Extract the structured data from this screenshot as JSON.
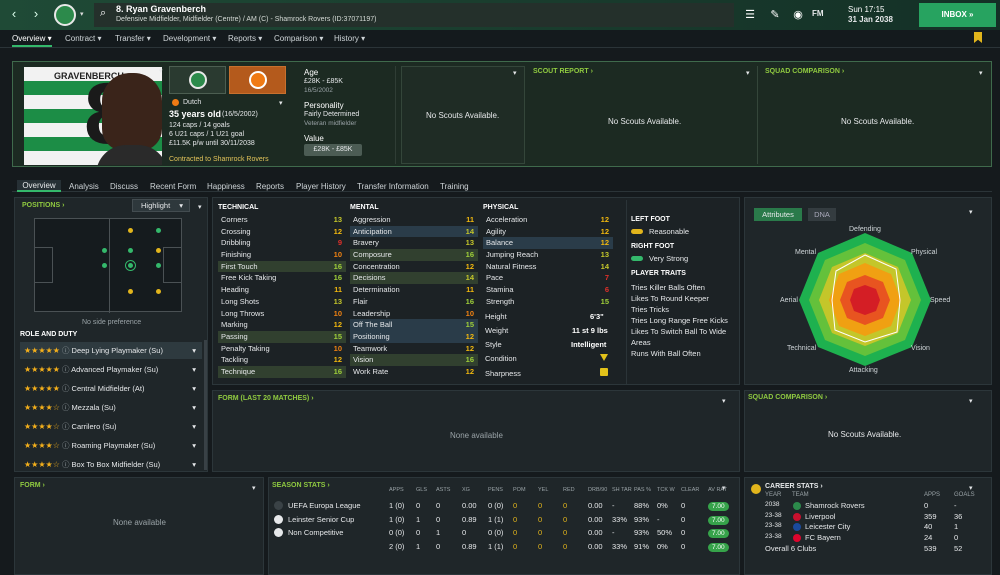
{
  "header": {
    "name": "8. Ryan Gravenberch",
    "subtitle": "Defensive Midfielder, Midfielder (Centre) / AM (C) - Shamrock Rovers (ID:37071197)",
    "time": "Sun 17:15",
    "date": "31 Jan 2038",
    "inbox": "INBOX",
    "fm": "FM"
  },
  "nav": [
    "Overview",
    "Contract",
    "Transfer",
    "Development",
    "Reports",
    "Comparison",
    "History"
  ],
  "profile": {
    "nationality": "Dutch",
    "age_line": "35 years old",
    "dob": "(16/5/2002)",
    "caps": "124 caps / 14 goals",
    "u21": "6 U21 caps / 1 U21 goal",
    "wage": "£11.5K p/w until 30/11/2038",
    "contract": "Contracted to Shamrock Rovers",
    "shirt_name": "GRAVENBERCH",
    "shirt_num": "8"
  },
  "age_box": {
    "label": "Age",
    "value": "£28K - £85K",
    "dob": "16/5/2002",
    "personality_label": "Personality",
    "personality": "Fairly Determined",
    "personality_sub": "Veteran midfielder",
    "value_label": "Value"
  },
  "scouts": {
    "none": "No Scouts Available.",
    "scout_report": "SCOUT REPORT",
    "squad_comparison": "SQUAD COMPARISON"
  },
  "subtabs": [
    "Overview",
    "Analysis",
    "Discuss",
    "Recent Form",
    "Happiness",
    "Reports",
    "Player History",
    "Transfer Information",
    "Training"
  ],
  "positions": {
    "title": "POSITIONS",
    "highlight": "Highlight",
    "side_pref": "No side preference"
  },
  "role": {
    "title": "ROLE AND DUTY",
    "items": [
      "Deep Lying Playmaker (Su)",
      "Advanced Playmaker (Su)",
      "Central Midfielder (At)",
      "Mezzala (Su)",
      "Carrilero (Su)",
      "Roaming Playmaker (Su)",
      "Box To Box Midfielder (Su)"
    ]
  },
  "technical": {
    "title": "TECHNICAL",
    "attrs": [
      [
        "Corners",
        "13"
      ],
      [
        "Crossing",
        "12"
      ],
      [
        "Dribbling",
        "9"
      ],
      [
        "Finishing",
        "10"
      ],
      [
        "First Touch",
        "16"
      ],
      [
        "Free Kick Taking",
        "16"
      ],
      [
        "Heading",
        "11"
      ],
      [
        "Long Shots",
        "13"
      ],
      [
        "Long Throws",
        "10"
      ],
      [
        "Marking",
        "12"
      ],
      [
        "Passing",
        "15"
      ],
      [
        "Penalty Taking",
        "10"
      ],
      [
        "Tackling",
        "12"
      ],
      [
        "Technique",
        "16"
      ]
    ]
  },
  "mental": {
    "title": "MENTAL",
    "attrs": [
      [
        "Aggression",
        "11"
      ],
      [
        "Anticipation",
        "14"
      ],
      [
        "Bravery",
        "13"
      ],
      [
        "Composure",
        "16"
      ],
      [
        "Concentration",
        "12"
      ],
      [
        "Decisions",
        "14"
      ],
      [
        "Determination",
        "11"
      ],
      [
        "Flair",
        "16"
      ],
      [
        "Leadership",
        "10"
      ],
      [
        "Off The Ball",
        "15"
      ],
      [
        "Positioning",
        "12"
      ],
      [
        "Teamwork",
        "12"
      ],
      [
        "Vision",
        "16"
      ],
      [
        "Work Rate",
        "12"
      ]
    ]
  },
  "physical": {
    "title": "PHYSICAL",
    "attrs": [
      [
        "Acceleration",
        "12"
      ],
      [
        "Agility",
        "12"
      ],
      [
        "Balance",
        "12"
      ],
      [
        "Jumping Reach",
        "13"
      ],
      [
        "Natural Fitness",
        "14"
      ],
      [
        "Pace",
        "7"
      ],
      [
        "Stamina",
        "6"
      ],
      [
        "Strength",
        "15"
      ]
    ],
    "height_label": "Height",
    "height": "6'3\"",
    "weight_label": "Weight",
    "weight": "11 st 9 lbs",
    "style_label": "Style",
    "style": "Intelligent",
    "condition_label": "Condition",
    "sharpness_label": "Sharpness"
  },
  "feet": {
    "left_label": "LEFT FOOT",
    "left": "Reasonable",
    "right_label": "RIGHT FOOT",
    "right": "Very Strong"
  },
  "traits": {
    "title": "PLAYER TRAITS",
    "items": [
      "Tries Killer Balls Often",
      "Likes To Round Keeper",
      "Tries Tricks",
      "Tries Long Range Free Kicks",
      "Likes To Switch Ball To Wide Areas",
      "Runs With Ball Often"
    ]
  },
  "radar": {
    "tabs": [
      "Attributes",
      "DNA"
    ],
    "labels": [
      "Defending",
      "Physical",
      "Speed",
      "Vision",
      "Attacking",
      "Technical",
      "Aerial",
      "Mental"
    ]
  },
  "form20": {
    "title": "FORM (LAST 20 MATCHES)",
    "none": "None available"
  },
  "form": {
    "title": "FORM",
    "none": "None available"
  },
  "season": {
    "title": "SEASON STATS",
    "cols": [
      "APPS",
      "GLS",
      "ASTS",
      "XG",
      "PENS",
      "POM",
      "YEL",
      "RED",
      "DRB/90",
      "SH TAR",
      "PAS %",
      "TCK W",
      "CLEAR",
      "AV RAT"
    ],
    "rows": [
      {
        "comp": "UEFA Europa League",
        "vals": [
          "1 (0)",
          "0",
          "0",
          "0.00",
          "0 (0)",
          "0",
          "0",
          "0",
          "0.00",
          "-",
          "88%",
          "0%",
          "0",
          "7.00"
        ]
      },
      {
        "comp": "Leinster Senior Cup",
        "vals": [
          "1 (0)",
          "1",
          "0",
          "0.89",
          "1 (1)",
          "0",
          "0",
          "0",
          "0.00",
          "33%",
          "93%",
          "-",
          "0",
          "7.00"
        ]
      },
      {
        "comp": "Non Competitive",
        "vals": [
          "0 (0)",
          "0",
          "1",
          "0",
          "0 (0)",
          "0",
          "0",
          "0",
          "0.00",
          "-",
          "93%",
          "50%",
          "0",
          "7.00"
        ]
      },
      {
        "comp": "",
        "vals": [
          "2 (0)",
          "1",
          "0",
          "0.89",
          "1 (1)",
          "0",
          "0",
          "0",
          "0.00",
          "33%",
          "91%",
          "0%",
          "0",
          "7.00"
        ]
      }
    ]
  },
  "career": {
    "title": "CAREER STATS",
    "cols": [
      "YEAR",
      "TEAM",
      "APPS",
      "GOALS"
    ],
    "rows": [
      [
        "2038",
        "Shamrock Rovers",
        "0",
        "-"
      ],
      [
        "23-38",
        "Liverpool",
        "359",
        "36"
      ],
      [
        "23-38",
        "Leicester City",
        "40",
        "1"
      ],
      [
        "23-38",
        "FC Bayern",
        "24",
        "0"
      ]
    ],
    "total_label": "Overall 6 Clubs",
    "total_apps": "539",
    "total_goals": "52"
  },
  "colors": {
    "accent": "#8fc940",
    "inbox": "#27a360"
  }
}
